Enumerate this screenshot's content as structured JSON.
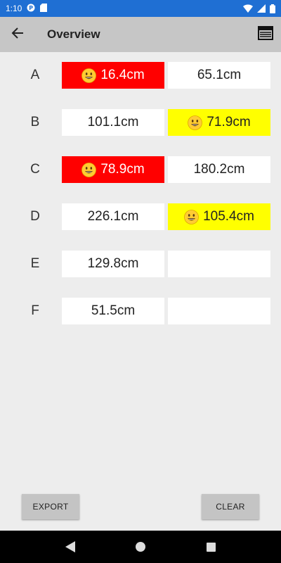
{
  "status_bar": {
    "time": "1:10",
    "icons": [
      "app-notification-icon",
      "sd-card-icon",
      "wifi-icon",
      "signal-icon",
      "battery-icon"
    ]
  },
  "app_bar": {
    "title": "Overview",
    "back_icon": "arrow-back-icon",
    "menu_icon": "calendar-view-icon"
  },
  "rows": [
    {
      "label": "A",
      "cells": [
        {
          "value": "16.4cm",
          "highlight": "red",
          "emoji": true
        },
        {
          "value": "65.1cm",
          "highlight": "none",
          "emoji": false
        }
      ]
    },
    {
      "label": "B",
      "cells": [
        {
          "value": "101.1cm",
          "highlight": "none",
          "emoji": false
        },
        {
          "value": "71.9cm",
          "highlight": "yellow",
          "emoji": true
        }
      ]
    },
    {
      "label": "C",
      "cells": [
        {
          "value": "78.9cm",
          "highlight": "red",
          "emoji": true
        },
        {
          "value": "180.2cm",
          "highlight": "none",
          "emoji": false
        }
      ]
    },
    {
      "label": "D",
      "cells": [
        {
          "value": "226.1cm",
          "highlight": "none",
          "emoji": false
        },
        {
          "value": "105.4cm",
          "highlight": "yellow",
          "emoji": true
        }
      ]
    },
    {
      "label": "E",
      "cells": [
        {
          "value": "129.8cm",
          "highlight": "none",
          "emoji": false
        },
        {
          "value": "",
          "highlight": "none",
          "emoji": false
        }
      ]
    },
    {
      "label": "F",
      "cells": [
        {
          "value": "51.5cm",
          "highlight": "none",
          "emoji": false
        },
        {
          "value": "",
          "highlight": "none",
          "emoji": false
        }
      ]
    }
  ],
  "buttons": {
    "export_label": "EXPORT",
    "clear_label": "CLEAR"
  },
  "colors": {
    "red_highlight": "#ff0000",
    "yellow_highlight": "#ffff00",
    "status_bar": "#1f6fd3",
    "app_bar": "#c6c6c6"
  }
}
